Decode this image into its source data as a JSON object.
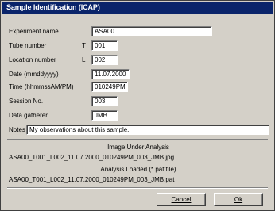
{
  "window": {
    "title": "Sample Identification (ICAP)"
  },
  "fields": [
    {
      "label": "Experiment name",
      "code": "",
      "value": "ASA00"
    },
    {
      "label": "Tube number",
      "code": "T",
      "value": "001"
    },
    {
      "label": "Location number",
      "code": "L",
      "value": "002"
    },
    {
      "label": "Date (mmddyyyy)",
      "code": "",
      "value": "11.07.2000"
    },
    {
      "label": "Time (hhmmssAM/PM)",
      "code": "",
      "value": "010249PM"
    },
    {
      "label": "Session No.",
      "code": "",
      "value": "003"
    },
    {
      "label": "Data gatherer",
      "code": "",
      "value": "JMB"
    }
  ],
  "notes": {
    "label": "Notes",
    "value": "My observations about this sample."
  },
  "image_section": {
    "heading": "Image Under Analysis",
    "filename": "ASA00_T001_L002_11.07.2000_010249PM_003_JMB.jpg"
  },
  "analysis_section": {
    "heading": "Analysis Loaded (*.pat file)",
    "filename": "ASA00_T001_L002_11.07.2000_010249PM_003_JMB.pat"
  },
  "buttons": {
    "cancel": "Cancel",
    "ok": "Ok"
  }
}
